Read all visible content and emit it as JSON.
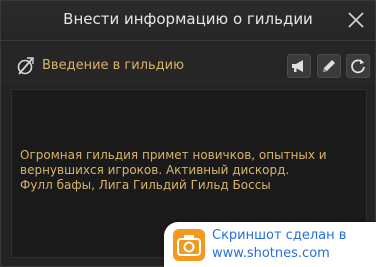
{
  "dialog": {
    "title": "Внести информацию о гильдии",
    "close_icon": "close-icon"
  },
  "section": {
    "icon": "guild-emblem-icon",
    "label": "Введение в гильдию"
  },
  "toolbar": {
    "announce_icon": "megaphone-icon",
    "edit_icon": "pencil-icon",
    "refresh_icon": "refresh-icon"
  },
  "content": {
    "description": "Огромная гильдия примет новичков, опытных и\nвернувшихся игроков. Активный дискорд.\nФулл бафы, Лига Гильдий Гильд Боссы"
  },
  "watermark": {
    "line1": "Скриншот сделан в",
    "line2": "www.shotnes.com"
  },
  "colors": {
    "accent_gold": "#d8b46a",
    "background": "#232323",
    "watermark_blue": "#2a6fd6",
    "watermark_orange": "#f39a1e"
  }
}
